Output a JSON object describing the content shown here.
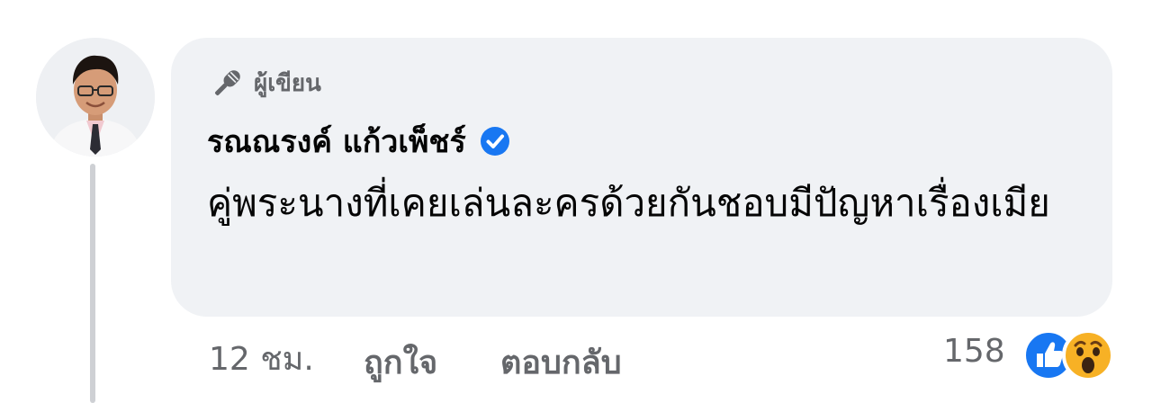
{
  "comment": {
    "author_badge": "ผู้เขียน",
    "author_badge_icon": "microphone-icon",
    "name": "รณณรงค์ แก้วเพ็ชร์",
    "verified_icon": "verified-badge-icon",
    "text": "คู่พระนางที่เคยเล่นละครด้วยกันชอบมีปัญหาเรื่องเมีย",
    "timestamp": "12 ชม.",
    "actions": {
      "like": "ถูกใจ",
      "reply": "ตอบกลับ"
    },
    "reactions": {
      "count": "158",
      "icons": [
        "like-reaction-icon",
        "wow-reaction-icon"
      ]
    }
  },
  "colors": {
    "bubble": "#f0f2f5",
    "text": "#050505",
    "secondary": "#65676b",
    "accent": "#1877f2",
    "thread_line": "#ced0d4"
  }
}
